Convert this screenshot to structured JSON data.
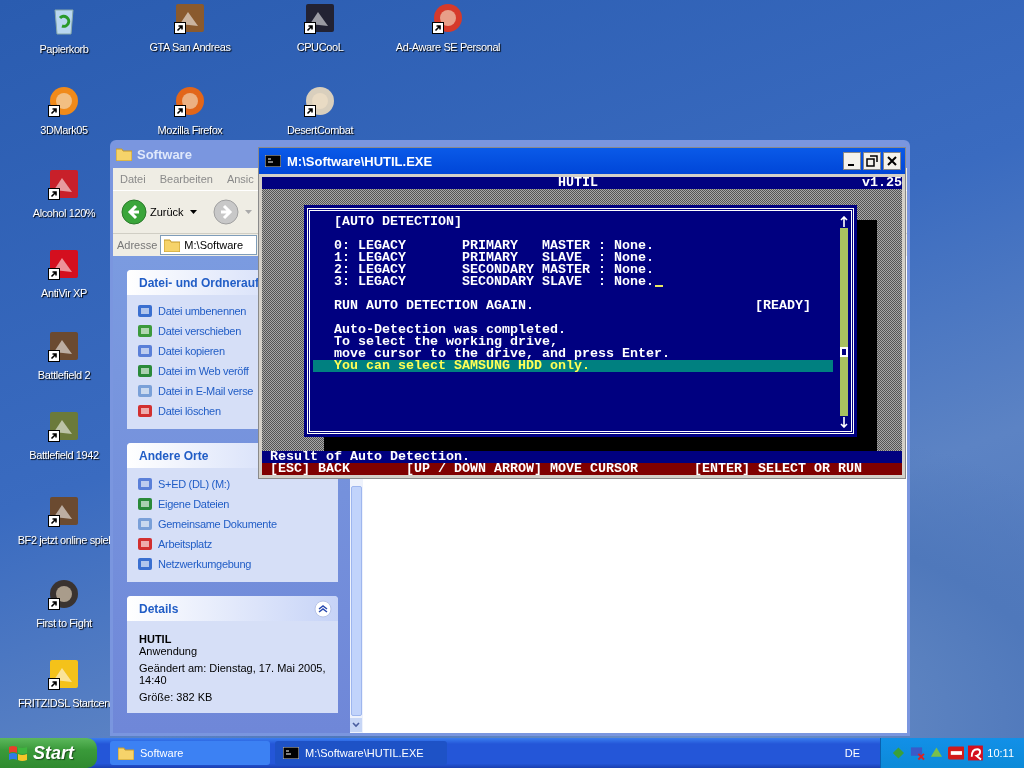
{
  "desktop_icons": [
    {
      "label": "Papierkorb",
      "shortcut": false
    },
    {
      "label": "GTA San Andreas",
      "shortcut": true
    },
    {
      "label": "CPUCooL",
      "shortcut": true
    },
    {
      "label": "Ad-Aware SE Personal",
      "shortcut": true
    },
    {
      "label": "3DMark05",
      "shortcut": true
    },
    {
      "label": "Mozilla Firefox",
      "shortcut": true
    },
    {
      "label": "DesertCombat",
      "shortcut": true
    },
    {
      "label": "Alcohol 120%",
      "shortcut": true
    },
    {
      "label": "AntiVir XP",
      "shortcut": true
    },
    {
      "label": "Battlefield 2",
      "shortcut": true
    },
    {
      "label": "Battlefield 1942",
      "shortcut": true
    },
    {
      "label": "BF2 jetzt online spiel",
      "shortcut": true
    },
    {
      "label": "First to Fight",
      "shortcut": true
    },
    {
      "label": "FRITZ!DSL Startcen",
      "shortcut": true
    }
  ],
  "explorer": {
    "title": "Software",
    "menu": [
      "Datei",
      "Bearbeiten",
      "Ansic"
    ],
    "back_button": "Zurück",
    "address_label": "Adresse",
    "address": "M:\\Software",
    "task_panels": [
      {
        "title": "Datei- und Ordnerauf",
        "items": [
          {
            "label": "Datei umbenennen"
          },
          {
            "label": "Datei verschieben"
          },
          {
            "label": "Datei kopieren"
          },
          {
            "label": "Datei im Web veröff"
          },
          {
            "label": "Datei in E-Mail verse"
          },
          {
            "label": "Datei löschen"
          }
        ]
      },
      {
        "title": "Andere Orte",
        "items": [
          {
            "label": "S+ED (DL) (M:)"
          },
          {
            "label": "Eigene Dateien"
          },
          {
            "label": "Gemeinsame Dokumente"
          },
          {
            "label": "Arbeitsplatz"
          },
          {
            "label": "Netzwerkumgebung"
          }
        ]
      }
    ],
    "details": {
      "title": "Details",
      "name": "HUTIL",
      "type": "Anwendung",
      "modified": "Geändert am: Dienstag, 17. Mai 2005, 14:40",
      "size": "Größe: 382 KB"
    }
  },
  "console": {
    "title": "M:\\Software\\HUTIL.EXE",
    "app_title": "HUTIL",
    "version": "v1.25",
    "dialog_title": "[AUTO DETECTION]",
    "drives": [
      {
        "text": "0: LEGACY       PRIMARY   MASTER : None.",
        "cursor": false
      },
      {
        "text": "1: LEGACY       PRIMARY   SLAVE  : None.",
        "cursor": false
      },
      {
        "text": "2: LEGACY       SECONDARY MASTER : None.",
        "cursor": false
      },
      {
        "text": "3: LEGACY       SECONDARY SLAVE  : None.",
        "cursor": true
      }
    ],
    "action": "RUN AUTO DETECTION AGAIN.",
    "action_status": "[READY]",
    "messages": [
      {
        "text": "Auto-Detection was completed.",
        "highlighted": false
      },
      {
        "text": "To select the working drive,",
        "highlighted": false
      },
      {
        "text": "move cursor to the drive, and press Enter.",
        "highlighted": false
      },
      {
        "text": "You can select SAMSUNG HDD only.",
        "highlighted": true
      }
    ],
    "status": "Result of Auto Detection.",
    "keys": [
      "[ESC] BACK",
      "[UP / DOWN ARROW] MOVE CURSOR",
      "[ENTER] SELECT OR RUN"
    ]
  },
  "taskbar": {
    "start": "Start",
    "buttons": [
      {
        "label": "Software",
        "selected": false,
        "kind": "folder"
      },
      {
        "label": "M:\\Software\\HUTIL.EXE",
        "selected": true,
        "kind": "console"
      }
    ],
    "language": "DE",
    "clock": "10:11"
  }
}
